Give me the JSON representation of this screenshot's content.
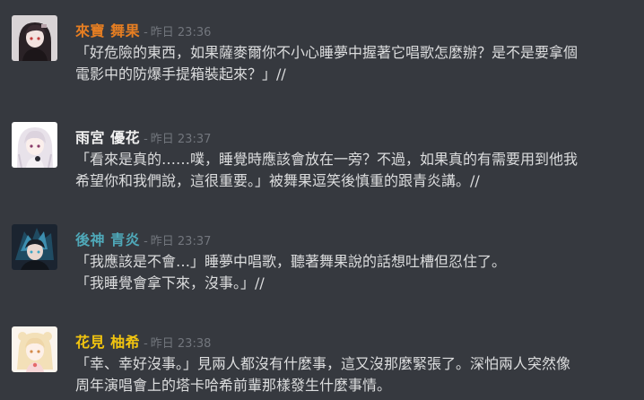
{
  "messages": [
    {
      "author": "來寶 舞果",
      "author_color": "#e67e22",
      "timestamp": "昨日 23:36",
      "lines": [
        "「好危險的東西，如果薩麥爾你不小心睡夢中握著它唱歌怎麼辦？是不是要拿個",
        "電影中的防爆手提箱裝起來？」//"
      ]
    },
    {
      "author": "雨宮 優花",
      "author_color": "#f0f0f0",
      "timestamp": "昨日 23:37",
      "lines": [
        "「看來是真的……噗，睡覺時應該會放在一旁？不過，如果真的有需要用到他我",
        "希望你和我們說，這很重要。」被舞果逗笑後慎重的跟青炎講。//"
      ]
    },
    {
      "author": "後神 青炎",
      "author_color": "#4fa8b8",
      "timestamp": "昨日 23:37",
      "lines": [
        "「我應該是不會…」睡夢中唱歌，聽著舞果說的話想吐槽但忍住了。",
        "「我睡覺會拿下來，沒事。」//"
      ]
    },
    {
      "author": "花見 柚希",
      "author_color": "#f1c40f",
      "timestamp": "昨日 23:38",
      "lines": [
        "「幸、幸好沒事。」見兩人都沒有什麼事，這又沒那麼緊張了。深怕兩人突然像",
        "周年演唱會上的塔卡哈希前輩那樣發生什麼事情。"
      ]
    }
  ],
  "timestamp_separator": "-",
  "colors": {
    "background": "#36393f",
    "text": "#dcddde",
    "muted": "#72767d"
  },
  "icons": [
    "avatar-maika-icon",
    "avatar-yuka-icon",
    "avatar-seien-icon",
    "avatar-yuzuki-icon"
  ]
}
